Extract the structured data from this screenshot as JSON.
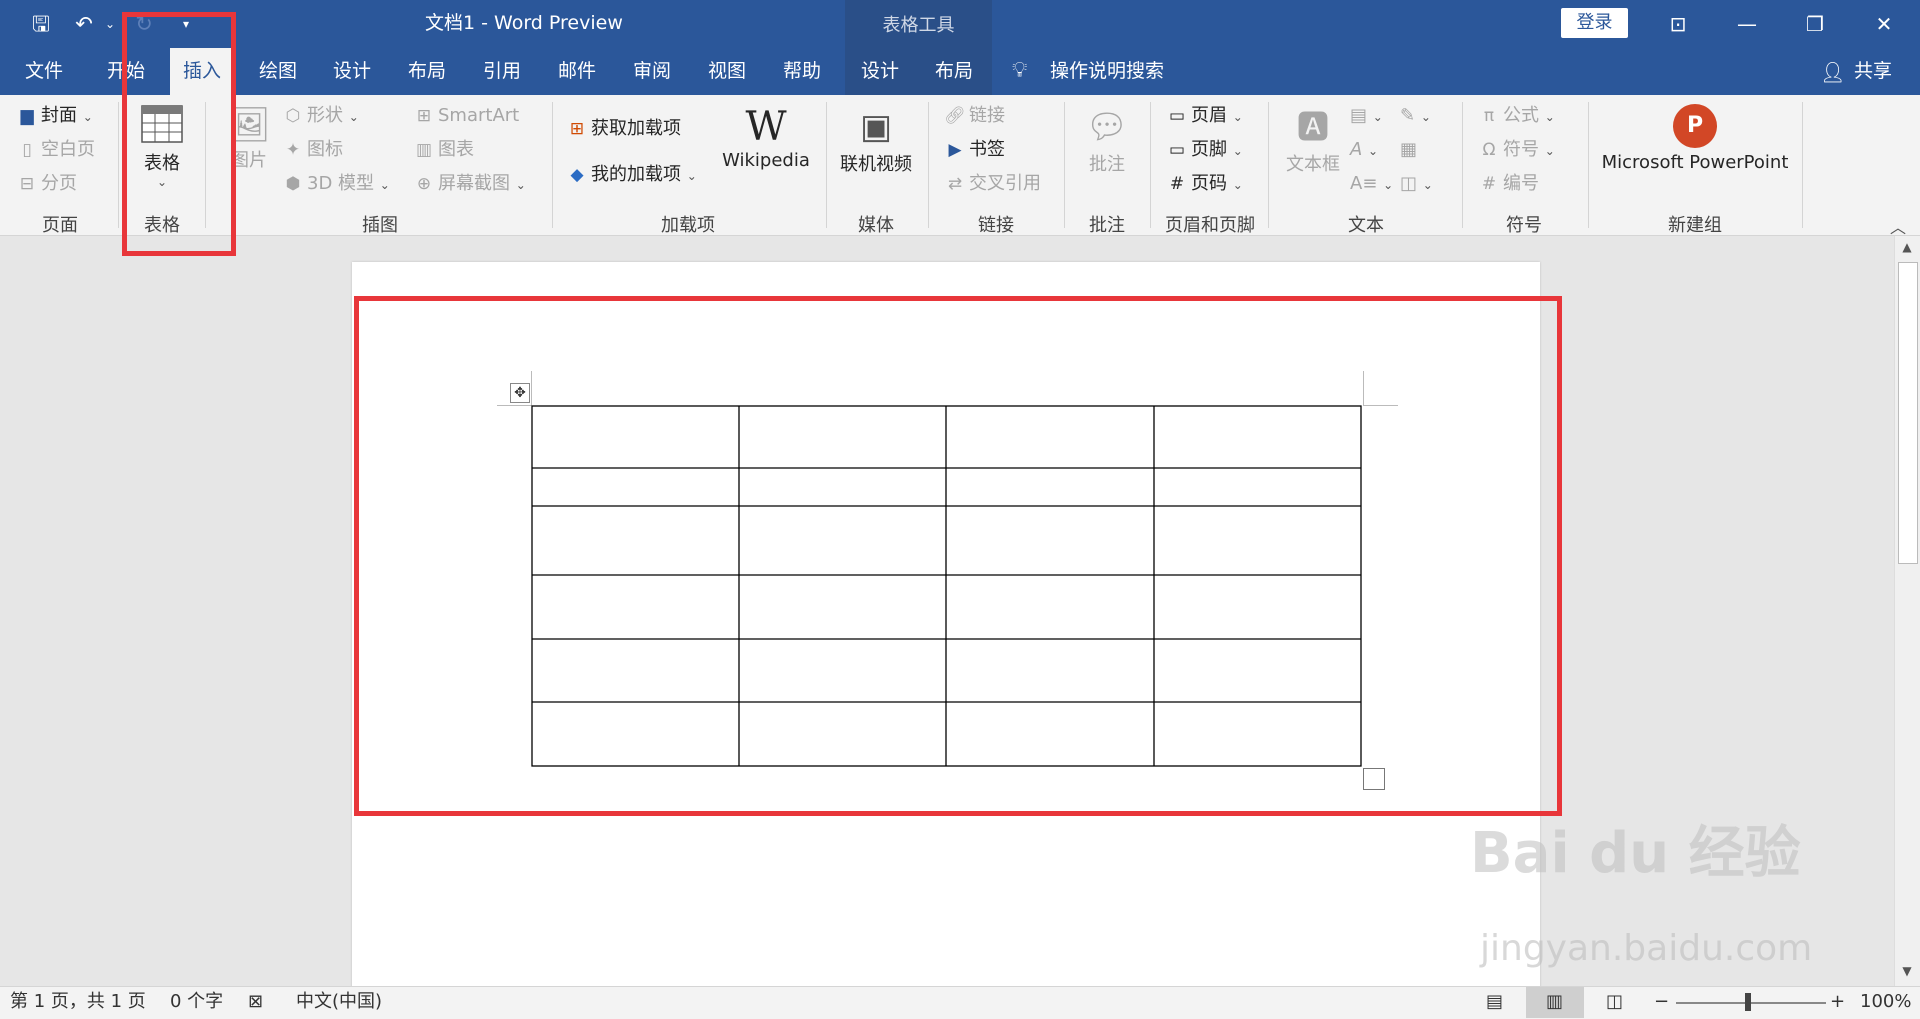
{
  "qat": {
    "save_icon": "save-icon",
    "undo_icon": "undo-icon",
    "redo_icon": "redo-icon",
    "customize_icon": "customize-qat-icon"
  },
  "window": {
    "title": "文档1  -  Word Preview",
    "contextual_group": "表格工具",
    "login": "登录",
    "share": "共享"
  },
  "tabs": [
    "文件",
    "开始",
    "插入",
    "绘图",
    "设计",
    "布局",
    "引用",
    "邮件",
    "审阅",
    "视图",
    "帮助",
    "设计",
    "布局"
  ],
  "active_tab": "插入",
  "tell_me": "操作说明搜索",
  "ribbon": {
    "pages": {
      "cover": "封面",
      "blank": "空白页",
      "break": "分页",
      "label": "页面"
    },
    "tables": {
      "table": "表格",
      "label": "表格"
    },
    "illustrations": {
      "pictures": "图片",
      "shapes": "形状",
      "icons": "图标",
      "models": "3D 模型",
      "smartart": "SmartArt",
      "chart": "图表",
      "screenshot": "屏幕截图",
      "label": "插图"
    },
    "addins": {
      "get": "获取加载项",
      "my": "我的加载项",
      "wiki": "Wikipedia",
      "label": "加载项"
    },
    "media": {
      "video": "联机视频",
      "label": "媒体"
    },
    "links": {
      "link": "链接",
      "bookmark": "书签",
      "crossref": "交叉引用",
      "label": "链接"
    },
    "comments": {
      "comment": "批注",
      "label": "批注"
    },
    "headerfooter": {
      "header": "页眉",
      "footer": "页脚",
      "pagenum": "页码",
      "label": "页眉和页脚"
    },
    "text": {
      "textbox": "文本框",
      "label": "文本"
    },
    "symbols": {
      "equation": "公式",
      "symbol": "符号",
      "number": "编号",
      "label": "符号"
    },
    "newgroup": {
      "ppt": "Microsoft PowerPoint",
      "label": "新建组"
    }
  },
  "table": {
    "rows": 6,
    "cols": 4
  },
  "status": {
    "page": "第 1 页，共 1 页",
    "words": "0 个字",
    "lang": "中文(中国)",
    "zoom": "100%"
  },
  "watermark": {
    "logo": "Bai du 经验",
    "url": "jingyan.baidu.com"
  }
}
